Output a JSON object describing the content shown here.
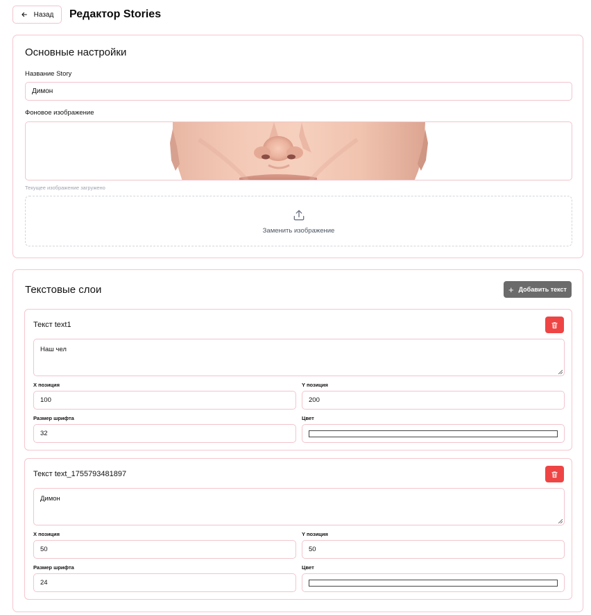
{
  "header": {
    "back_label": "Назад",
    "title": "Редактор Stories"
  },
  "basic_settings": {
    "heading": "Основные настройки",
    "name_label": "Название Story",
    "name_value": "Димон",
    "bg_label": "Фоновое изображение",
    "bg_status": "Текущее изображение загружено",
    "replace_label": "Заменить изображение"
  },
  "text_layers": {
    "heading": "Текстовые слои",
    "add_label": "Добавить текст",
    "x_label": "X позиция",
    "y_label": "Y позиция",
    "size_label": "Размер шрифта",
    "color_label": "Цвет",
    "layers": [
      {
        "title": "Текст text1",
        "text": "Наш чел",
        "x": "100",
        "y": "200",
        "font_size": "32",
        "color": "#ffffff"
      },
      {
        "title": "Текст text_1755793481897",
        "text": "Димон",
        "x": "50",
        "y": "50",
        "font_size": "24",
        "color": "#ffffff"
      }
    ]
  },
  "colors": {
    "border": "#f5c6ce",
    "delete_button": "#ef4444",
    "add_button": "#6b6b6b"
  }
}
